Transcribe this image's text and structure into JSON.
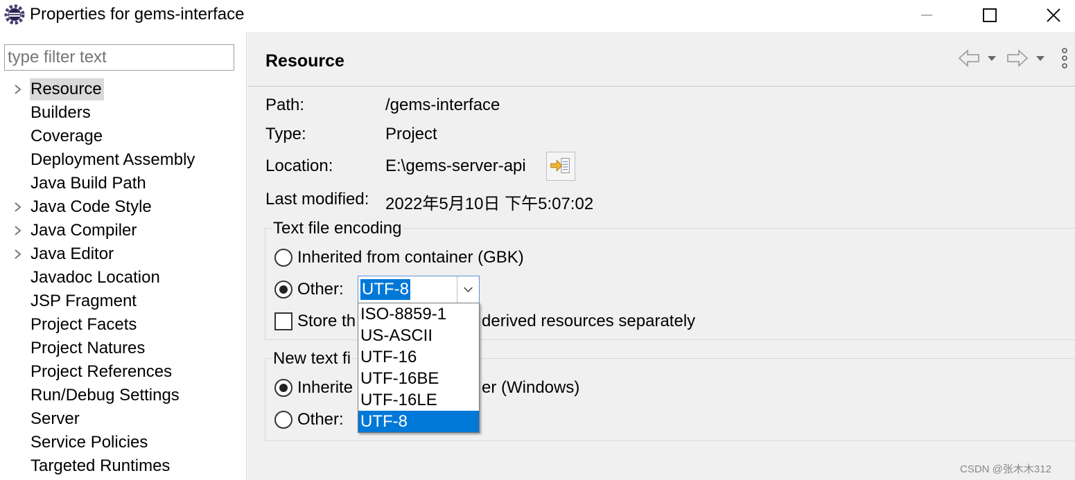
{
  "window": {
    "title": "Properties for gems-interface",
    "icon": "eclipse-gear-icon",
    "controls": [
      "minimize-icon",
      "maximize-icon",
      "close-icon"
    ]
  },
  "filter": {
    "placeholder": "type filter text",
    "value": ""
  },
  "tree": {
    "items": [
      {
        "label": "Resource",
        "expandable": true,
        "selected": true
      },
      {
        "label": "Builders",
        "expandable": false
      },
      {
        "label": "Coverage",
        "expandable": false
      },
      {
        "label": "Deployment Assembly",
        "expandable": false
      },
      {
        "label": "Java Build Path",
        "expandable": false
      },
      {
        "label": "Java Code Style",
        "expandable": true
      },
      {
        "label": "Java Compiler",
        "expandable": true
      },
      {
        "label": "Java Editor",
        "expandable": true
      },
      {
        "label": "Javadoc Location",
        "expandable": false
      },
      {
        "label": "JSP Fragment",
        "expandable": false
      },
      {
        "label": "Project Facets",
        "expandable": false
      },
      {
        "label": "Project Natures",
        "expandable": false
      },
      {
        "label": "Project References",
        "expandable": false
      },
      {
        "label": "Run/Debug Settings",
        "expandable": false
      },
      {
        "label": "Server",
        "expandable": false
      },
      {
        "label": "Service Policies",
        "expandable": false
      },
      {
        "label": "Targeted Runtimes",
        "expandable": false
      }
    ]
  },
  "page": {
    "title": "Resource",
    "nav_icons": [
      "back-arrow-icon",
      "chevron-down-icon",
      "forward-arrow-icon",
      "chevron-down-icon",
      "more-vertical-icon"
    ],
    "props": {
      "path_label": "Path:",
      "path_value": "/gems-interface",
      "type_label": "Type:",
      "type_value": "Project",
      "location_label": "Location:",
      "location_value": "E:\\gems-server-api",
      "modified_label": "Last modified:",
      "modified_value": "2022年5月10日 下午5:07:02"
    },
    "encoding": {
      "group_title": "Text file encoding",
      "inherited_label": "Inherited from container (GBK)",
      "other_label": "Other:",
      "other_selected": true,
      "combo_value": "UTF-8",
      "store_label_left": "Store th",
      "store_label_right": "derived resources separately",
      "store_checked": false
    },
    "dropdown": {
      "options": [
        "ISO-8859-1",
        "US-ASCII",
        "UTF-16",
        "UTF-16BE",
        "UTF-16LE",
        "UTF-8"
      ],
      "selected_index": 5
    },
    "delimiter": {
      "group_title": "New text fi",
      "inherited_label_left": "Inherite",
      "inherited_label_right": "er (Windows)",
      "inherited_selected": true,
      "other_label": "Other:"
    }
  },
  "watermark": "CSDN @张木木312",
  "colors": {
    "selection": "#0078d7",
    "panel_bg": "#f0f0f0",
    "tree_selected": "#d9d9d9"
  }
}
